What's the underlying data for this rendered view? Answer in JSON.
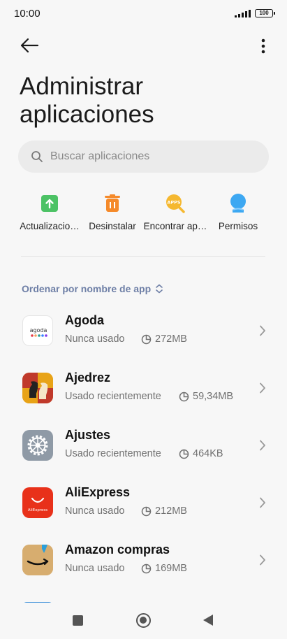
{
  "status_bar": {
    "time": "10:00",
    "battery": "100"
  },
  "page": {
    "title": "Administrar aplicaciones"
  },
  "search": {
    "placeholder": "Buscar aplicaciones"
  },
  "actions": [
    {
      "label": "Actualizacio…",
      "icon": "update-icon",
      "color": "#4cc265"
    },
    {
      "label": "Desinstalar",
      "icon": "trash-icon",
      "color": "#f58a2a"
    },
    {
      "label": "Encontrar ap…",
      "icon": "find-apps-icon",
      "color": "#f5b830"
    },
    {
      "label": "Permisos",
      "icon": "permissions-icon",
      "color": "#3da8f2"
    }
  ],
  "sort": {
    "label": "Ordenar por nombre de app"
  },
  "apps": [
    {
      "name": "Agoda",
      "usage": "Nunca usado",
      "size": "272MB",
      "icon": "agoda-icon"
    },
    {
      "name": "Ajedrez",
      "usage": "Usado recientemente",
      "size": "59,34MB",
      "icon": "chess-icon"
    },
    {
      "name": "Ajustes",
      "usage": "Usado recientemente",
      "size": "464KB",
      "icon": "settings-gear-icon"
    },
    {
      "name": "AliExpress",
      "usage": "Nunca usado",
      "size": "212MB",
      "icon": "aliexpress-icon"
    },
    {
      "name": "Amazon compras",
      "usage": "Nunca usado",
      "size": "169MB",
      "icon": "amazon-icon"
    }
  ],
  "icon_texts": {
    "agoda": "agoda",
    "aliexpress": "AliExpress",
    "apps": "APPS"
  }
}
